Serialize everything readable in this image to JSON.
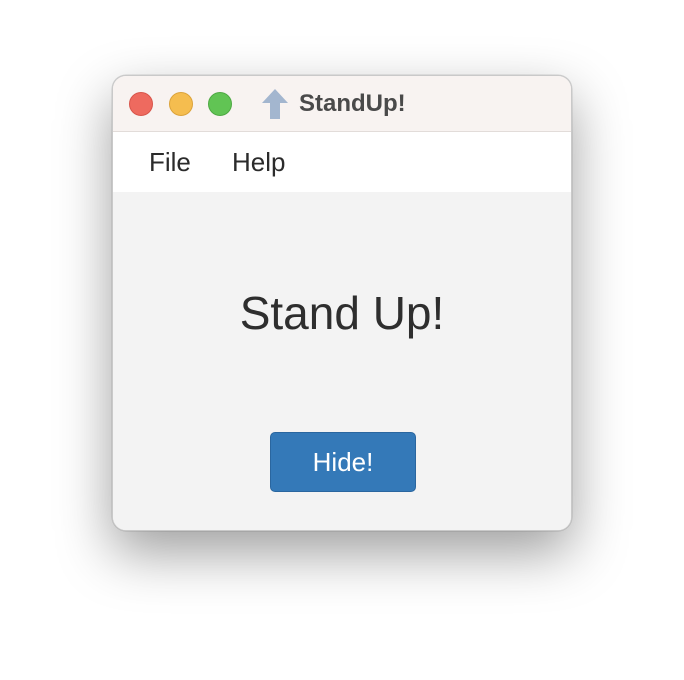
{
  "window": {
    "title": "StandUp!",
    "title_icon": "up-arrow-icon",
    "controls": [
      "close",
      "minimize",
      "maximize"
    ]
  },
  "menu": {
    "items": [
      {
        "label": "File"
      },
      {
        "label": "Help"
      }
    ]
  },
  "main": {
    "heading": "Stand Up!",
    "hide_label": "Hide!"
  },
  "colors": {
    "accent": "#3479b8",
    "close": "#ee6a5f",
    "minimize": "#f5bd4f",
    "maximize": "#61c454",
    "icon": "#a3b6cf"
  }
}
